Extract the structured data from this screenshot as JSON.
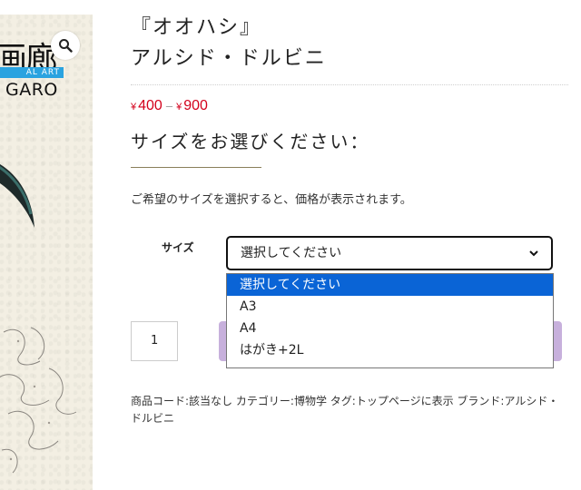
{
  "product_image": {
    "brand_kanji": "画廊",
    "brand_strip_text": "AL ART",
    "brand_name": "GARO",
    "zoom_icon": "magnifier-icon"
  },
  "product": {
    "title_line1": "『オオハシ』",
    "title_line2": "アルシド・ドルビニ",
    "price_min": "400",
    "price_max": "900",
    "currency_symbol": "¥",
    "price_separator": "–",
    "price_color": "#d3001b"
  },
  "variation": {
    "heading": "サイズをお選びください：",
    "instructions": "ご希望のサイズを選択すると、価格が表示されます。",
    "size_label": "サイズ",
    "select_value": "選択してください",
    "options": [
      "選択してください",
      "A3",
      "A4",
      "はがき+2L"
    ],
    "selected_index": 0
  },
  "cart": {
    "quantity": "1",
    "button_color": "#c7b0dc"
  },
  "meta": {
    "sku_label": "商品コード:",
    "sku_value": "該当なし",
    "category_label": "カテゴリー:",
    "category_value": "博物学",
    "tag_label": "タグ:",
    "tag_value": "トップページに表示",
    "brand_label": "ブランド:",
    "brand_value": "アルシド・ドルビニ"
  },
  "colors": {
    "selected_option_bg": "#0a64d6",
    "brand_strip": "#2aa3e0"
  }
}
